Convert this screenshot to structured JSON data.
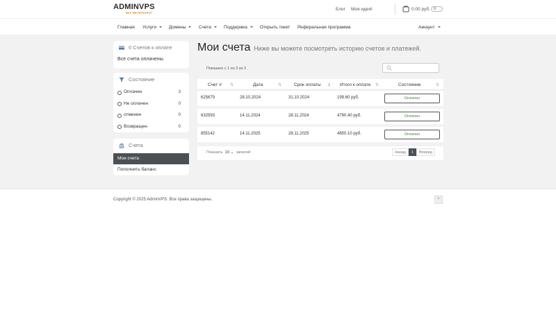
{
  "header": {
    "logo_brand": "ADMINVPS",
    "logo_tagline": "все включено!",
    "links": [
      {
        "label": "Блог"
      },
      {
        "label": "Моя идея!"
      }
    ],
    "cart_sum": "0.00 руб.",
    "toggle_value": "0"
  },
  "nav": {
    "items": [
      {
        "label": "Главная"
      },
      {
        "label": "Услуги"
      },
      {
        "label": "Домены"
      },
      {
        "label": "Счета"
      },
      {
        "label": "Поддержка"
      },
      {
        "label": "Открыть тикет"
      },
      {
        "label": "Реферальная программа"
      }
    ],
    "account_label": "Аккаунт"
  },
  "sidebar": {
    "unpaid": {
      "title": "0 Счетов к оплате",
      "body": "Все счета оплачены."
    },
    "status": {
      "title": "Состояние",
      "items": [
        {
          "label": "Оплачен",
          "count": "3"
        },
        {
          "label": "Не оплачен",
          "count": "0"
        },
        {
          "label": "отменен",
          "count": "0"
        },
        {
          "label": "Возвращен",
          "count": "0"
        }
      ]
    },
    "invoices": {
      "title": "Счета",
      "items": [
        {
          "label": "Мои счета",
          "active": true
        },
        {
          "label": "Пополнить баланс",
          "active": false
        }
      ]
    }
  },
  "main": {
    "title": "Мои счета",
    "subtitle": "Ниже вы можете посмотреть историю счетов и платежей.",
    "showing": "Показано с 1 по 3 из 3",
    "search_placeholder": "",
    "columns": [
      "Счет #",
      "Дата",
      "Срок оплаты",
      "Итого к оплате",
      "Состояние"
    ],
    "rows": [
      {
        "id": "625679",
        "date": "28.10.2024",
        "due": "31.10.2024",
        "total": "199.60 руб.",
        "status": "Оплачен"
      },
      {
        "id": "632593",
        "date": "14.11.2024",
        "due": "28.11.2024",
        "total": "4790.40 руб.",
        "status": "Оплачен"
      },
      {
        "id": "855142",
        "date": "14.11.2025",
        "due": "28.11.2025",
        "total": "4850.10 руб.",
        "status": "Оплачен"
      }
    ],
    "per_page_prefix": "Показать",
    "per_page_value": "10",
    "per_page_suffix": "записей",
    "pager": {
      "prev": "Назад",
      "current": "1",
      "next": "Вперед"
    }
  },
  "footer": {
    "copyright": "Copyright © 2025 AdminVPS. Все права защищены.",
    "to_top": "^"
  },
  "colors": {
    "accent": "#e07a1f",
    "active_bg": "#4b5055",
    "paid_green": "#3d8b2f"
  }
}
